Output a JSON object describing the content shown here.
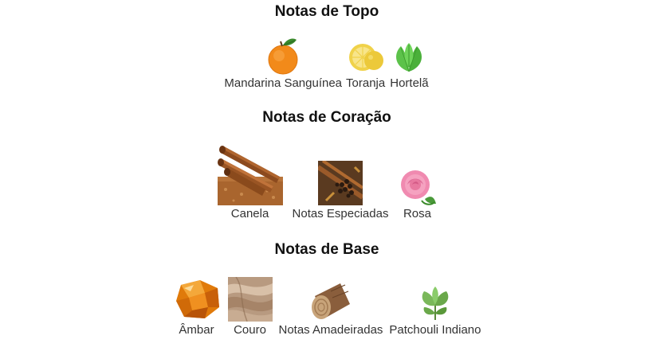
{
  "sections": [
    {
      "title": "Notas de Topo",
      "notes": [
        {
          "label": "Mandarina Sanguínea",
          "icon": "mandarin-orange-icon"
        },
        {
          "label": "Toranja",
          "icon": "grapefruit-icon"
        },
        {
          "label": "Hortelã",
          "icon": "mint-leaves-icon"
        }
      ]
    },
    {
      "title": "Notas de Coração",
      "notes": [
        {
          "label": "Canela",
          "icon": "cinnamon-sticks-icon"
        },
        {
          "label": "Notas Especiadas",
          "icon": "spices-icon"
        },
        {
          "label": "Rosa",
          "icon": "pink-rose-icon"
        }
      ]
    },
    {
      "title": "Notas de Base",
      "notes": [
        {
          "label": "Âmbar",
          "icon": "amber-stone-icon"
        },
        {
          "label": "Couro",
          "icon": "leather-icon"
        },
        {
          "label": "Notas Amadeiradas",
          "icon": "wood-log-icon"
        },
        {
          "label": "Patchouli Indiano",
          "icon": "patchouli-leaves-icon"
        }
      ]
    }
  ]
}
